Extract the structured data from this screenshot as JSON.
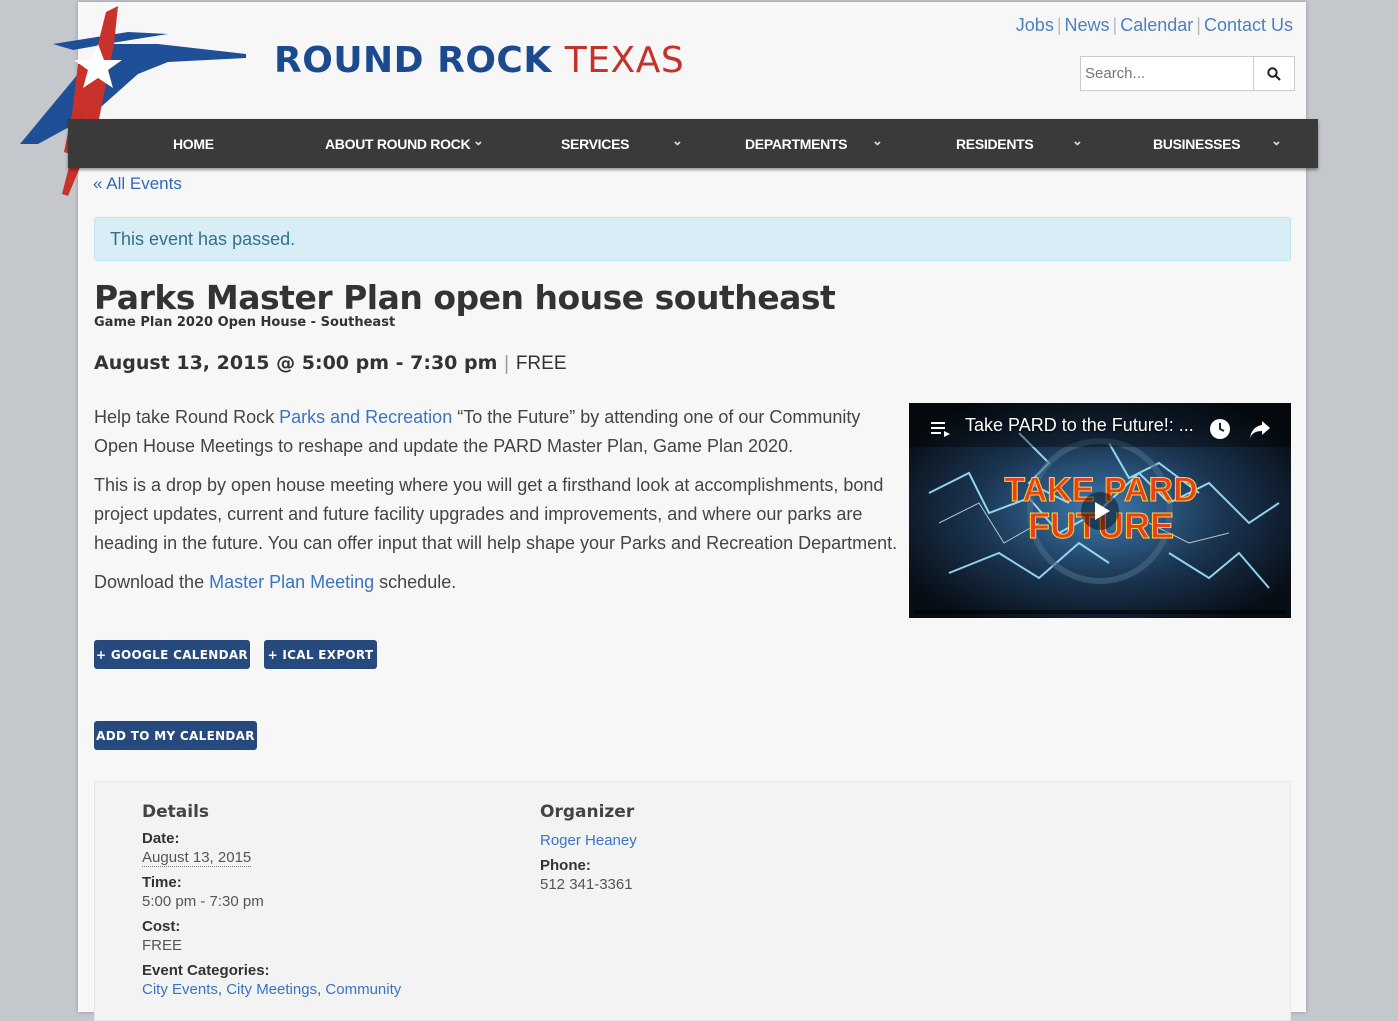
{
  "brand": {
    "round_rock": "ROUND ROCK",
    "texas": "TEXAS"
  },
  "top_links": [
    "Jobs",
    "News",
    "Calendar",
    "Contact Us"
  ],
  "search": {
    "placeholder": "Search..."
  },
  "nav": [
    "HOME",
    "ABOUT ROUND ROCK",
    "SERVICES",
    "DEPARTMENTS",
    "RESIDENTS",
    "BUSINESSES"
  ],
  "back_link": "« All Events",
  "notice": "This event has passed.",
  "event": {
    "title": "Parks Master Plan open house southeast",
    "subtitle": "Game Plan 2020 Open House - Southeast",
    "datetime": "August 13, 2015 @ 5:00 pm - 7:30 pm",
    "cost": "FREE"
  },
  "description": {
    "p1_pre": "Help take Round Rock ",
    "p1_link": "Parks and Recreation",
    "p1_post": " “To the Future” by attending one of our Community Open House Meetings to reshape and update the PARD Master Plan, Game Plan 2020.",
    "p2": "This is a drop by open house meeting where you will get a firsthand look at accomplishments, bond project updates, current and future facility upgrades and improvements, and where our parks are heading in the future. You can offer input that will help shape your Parks and Recreation Department.",
    "p3_pre": "Download the ",
    "p3_link": "Master Plan Meeting",
    "p3_post": " schedule."
  },
  "video": {
    "title": "Take PARD to the Future!: ..."
  },
  "buttons": {
    "google": "+ GOOGLE CALENDAR",
    "ical": "+ ICAL EXPORT",
    "add": "ADD TO MY CALENDAR"
  },
  "details": {
    "heading": "Details",
    "date_label": "Date:",
    "date_value": "August 13, 2015",
    "time_label": "Time:",
    "time_value": "5:00 pm - 7:30 pm",
    "cost_label": "Cost:",
    "cost_value": "FREE",
    "categories_label": "Event Categories:",
    "categories": [
      "City Events",
      "City Meetings",
      "Community"
    ]
  },
  "organizer": {
    "heading": "Organizer",
    "name": "Roger Heaney",
    "phone_label": "Phone:",
    "phone": "512 341-3361"
  },
  "colors": {
    "brand_blue": "#1c4a8e",
    "brand_red": "#c4322a",
    "button_blue": "#264a7e",
    "link": "#3b73c2"
  }
}
